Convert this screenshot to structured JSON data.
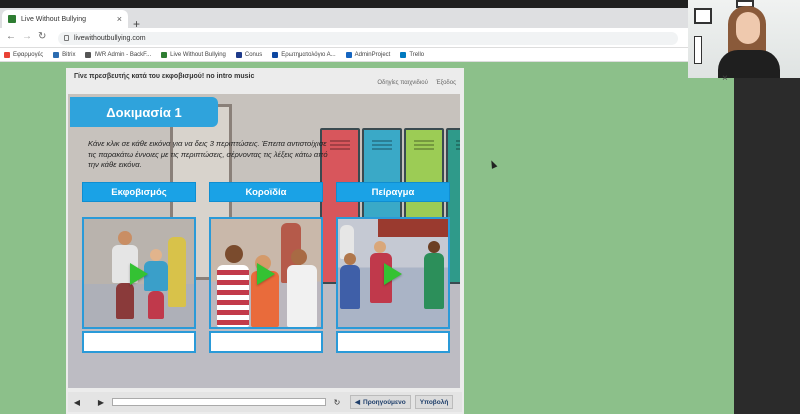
{
  "browser": {
    "tab_title": "Live Without Bullying",
    "tab_close": "×",
    "new_tab": "+",
    "url": "livewithoutbullying.com",
    "bookmarks": [
      {
        "label": "Εφαρμογές",
        "color": "#e94235"
      },
      {
        "label": "Bitrix",
        "color": "#2b6cb0"
      },
      {
        "label": "IWR Admin - BackF...",
        "color": "#555555"
      },
      {
        "label": "Live Without Bullying",
        "color": "#2e7d32"
      },
      {
        "label": "Conus",
        "color": "#1e3a8a"
      },
      {
        "label": "Ερωτηματολόγιο Α...",
        "color": "#0d47a1"
      },
      {
        "label": "AdminProject",
        "color": "#1565c0"
      },
      {
        "label": "Trello",
        "color": "#0079bf"
      }
    ]
  },
  "game": {
    "title": "Γίνε πρεσβευτής κατά του εκφοβισμού! no intro music",
    "links": {
      "instructions": "Οδηγίες παιχνιδιού",
      "exit": "Έξοδος"
    },
    "task_title": "Δοκιμασία 1",
    "instructions": "Κάνε κλικ σε κάθε εικόνα για να δεις 3 περιπτώσεις. Έπειτα αντιστοίχισε τις παρακάτω έννοιες με τις περιπτώσεις, σέρνοντας τις λέξεις κάτω από την κάθε εικόνα.",
    "labels": [
      "Εκφοβισμός",
      "Κοροϊδία",
      "Πείραγμα"
    ],
    "controls": {
      "prev": "Προηγούμενο",
      "submit": "Υποβολή"
    }
  },
  "colors": {
    "accent": "#2fa3dc",
    "label_button": "#1aa2e6",
    "play": "#34c233",
    "background": "#8cc08a"
  }
}
